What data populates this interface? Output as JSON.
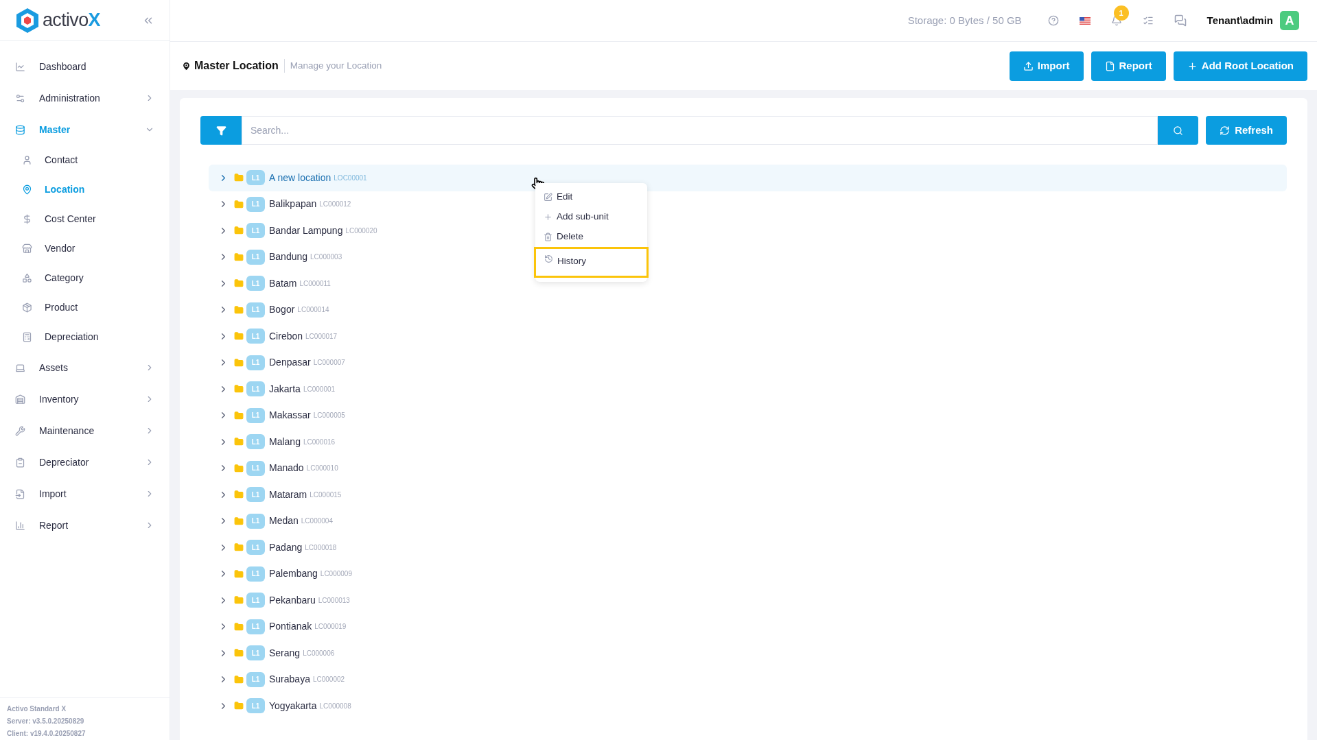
{
  "logo": {
    "text": "activo",
    "accent": "X"
  },
  "sidebar": {
    "items": [
      {
        "label": "Dashboard",
        "selected": false
      },
      {
        "label": "Administration",
        "selected": false,
        "expanded": false
      },
      {
        "label": "Master",
        "selected": true,
        "expanded": true,
        "children": [
          {
            "label": "Contact",
            "selected": false
          },
          {
            "label": "Location",
            "selected": true
          },
          {
            "label": "Cost Center",
            "selected": false
          },
          {
            "label": "Vendor",
            "selected": false
          },
          {
            "label": "Category",
            "selected": false
          },
          {
            "label": "Product",
            "selected": false
          },
          {
            "label": "Depreciation",
            "selected": false
          }
        ]
      },
      {
        "label": "Assets",
        "selected": false,
        "expanded": false
      },
      {
        "label": "Inventory",
        "selected": false,
        "expanded": false
      },
      {
        "label": "Maintenance",
        "selected": false,
        "expanded": false
      },
      {
        "label": "Depreciator",
        "selected": false,
        "expanded": false
      },
      {
        "label": "Import",
        "selected": false,
        "expanded": false
      },
      {
        "label": "Report",
        "selected": false,
        "expanded": false
      }
    ],
    "footer": [
      "Activo Standard X",
      "Server: v3.5.0.20250829",
      "Client: v19.4.0.20250827"
    ]
  },
  "top_bar": {
    "storage": "Storage: 0 Bytes / 50 GB",
    "notification_count": "1",
    "user": "Tenant\\admin",
    "avatar": "A"
  },
  "page_header": {
    "title": "Master Location",
    "subtitle": "Manage your Location",
    "buttons": [
      "Import",
      "Report",
      "Add Root Location"
    ]
  },
  "search": {
    "placeholder": "Search...",
    "refresh": "Refresh"
  },
  "tree": [
    {
      "name": "A new location",
      "code": "LOC00001",
      "level": "L1",
      "selected": true
    },
    {
      "name": "Balikpapan",
      "code": "LC000012",
      "level": "L1",
      "selected": false
    },
    {
      "name": "Bandar Lampung",
      "code": "LC000020",
      "level": "L1",
      "selected": false
    },
    {
      "name": "Bandung",
      "code": "LC000003",
      "level": "L1",
      "selected": false
    },
    {
      "name": "Batam",
      "code": "LC000011",
      "level": "L1",
      "selected": false
    },
    {
      "name": "Bogor",
      "code": "LC000014",
      "level": "L1",
      "selected": false
    },
    {
      "name": "Cirebon",
      "code": "LC000017",
      "level": "L1",
      "selected": false
    },
    {
      "name": "Denpasar",
      "code": "LC000007",
      "level": "L1",
      "selected": false
    },
    {
      "name": "Jakarta",
      "code": "LC000001",
      "level": "L1",
      "selected": false
    },
    {
      "name": "Makassar",
      "code": "LC000005",
      "level": "L1",
      "selected": false
    },
    {
      "name": "Malang",
      "code": "LC000016",
      "level": "L1",
      "selected": false
    },
    {
      "name": "Manado",
      "code": "LC000010",
      "level": "L1",
      "selected": false
    },
    {
      "name": "Mataram",
      "code": "LC000015",
      "level": "L1",
      "selected": false
    },
    {
      "name": "Medan",
      "code": "LC000004",
      "level": "L1",
      "selected": false
    },
    {
      "name": "Padang",
      "code": "LC000018",
      "level": "L1",
      "selected": false
    },
    {
      "name": "Palembang",
      "code": "LC000009",
      "level": "L1",
      "selected": false
    },
    {
      "name": "Pekanbaru",
      "code": "LC000013",
      "level": "L1",
      "selected": false
    },
    {
      "name": "Pontianak",
      "code": "LC000019",
      "level": "L1",
      "selected": false
    },
    {
      "name": "Serang",
      "code": "LC000006",
      "level": "L1",
      "selected": false
    },
    {
      "name": "Surabaya",
      "code": "LC000002",
      "level": "L1",
      "selected": false
    },
    {
      "name": "Yogyakarta",
      "code": "LC000008",
      "level": "L1",
      "selected": false
    }
  ],
  "context_menu": {
    "items": [
      {
        "label": "Edit",
        "selected": false
      },
      {
        "label": "Add sub-unit",
        "selected": false
      },
      {
        "label": "Delete",
        "selected": false
      },
      {
        "label": "History",
        "selected": true
      }
    ]
  }
}
